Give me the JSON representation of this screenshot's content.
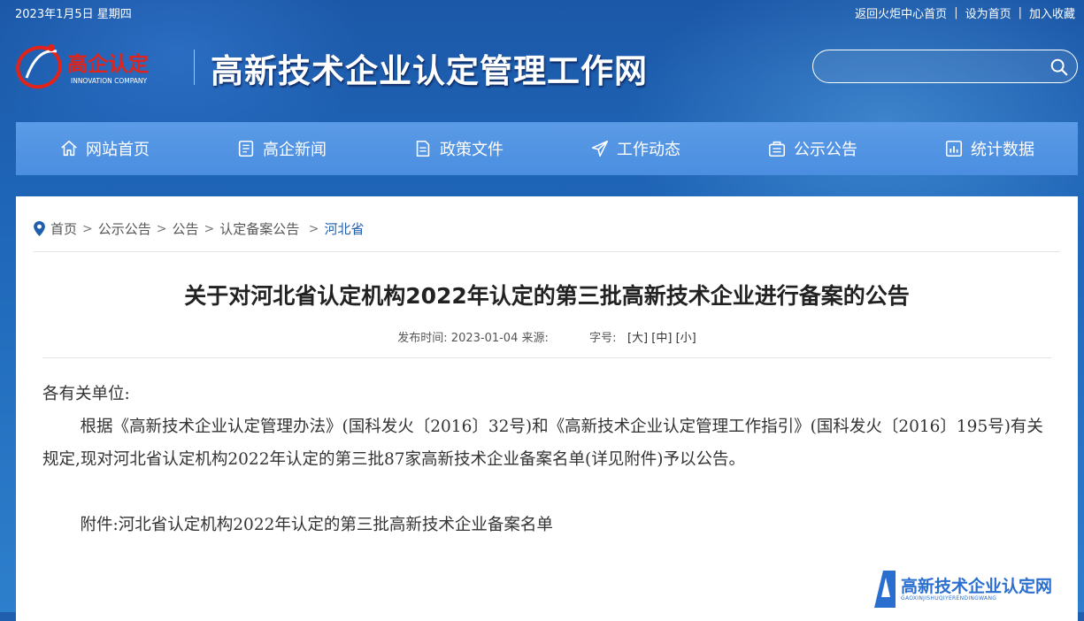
{
  "topbar": {
    "date": "2023年1月5日 星期四",
    "links": [
      "返回火炬中心首页",
      "设为首页",
      "加入收藏"
    ]
  },
  "logo": {
    "cn": "高企认定",
    "en": "INNOVATION COMPANY"
  },
  "site_title": "高新技术企业认定管理工作网",
  "search": {
    "placeholder": ""
  },
  "nav": [
    {
      "label": "网站首页",
      "icon": "home-icon"
    },
    {
      "label": "高企新闻",
      "icon": "news-icon"
    },
    {
      "label": "政策文件",
      "icon": "document-icon"
    },
    {
      "label": "工作动态",
      "icon": "send-icon"
    },
    {
      "label": "公示公告",
      "icon": "notice-icon"
    },
    {
      "label": "统计数据",
      "icon": "chart-icon"
    }
  ],
  "breadcrumb": [
    "首页",
    "公示公告",
    "公告",
    "认定备案公告",
    "河北省"
  ],
  "article": {
    "title": "关于对河北省认定机构2022年认定的第三批高新技术企业进行备案的公告",
    "publish_label": "发布时间:",
    "publish_date": "2023-01-04",
    "source_label": "来源:",
    "fontsize_label": "字号:",
    "font_sizes": [
      "[大]",
      "[中]",
      "[小]"
    ],
    "greeting": "各有关单位:",
    "paragraph": "根据《高新技术企业认定管理办法》(国科发火〔2016〕32号)和《高新技术企业认定管理工作指引》(国科发火〔2016〕195号)有关规定,现对河北省认定机构2022年认定的第三批87家高新技术企业备案名单(详见附件)予以公告。",
    "attachment": "附件:河北省认定机构2022年认定的第三批高新技术企业备案名单"
  },
  "watermark": {
    "title": "高新技术企业认定网",
    "sub": "GAOXINJISHUQIYERENDINGWANG"
  },
  "colors": {
    "brand_blue": "#1f5fae",
    "nav_blue": "#4b8ee0",
    "logo_red": "#e2231a"
  }
}
